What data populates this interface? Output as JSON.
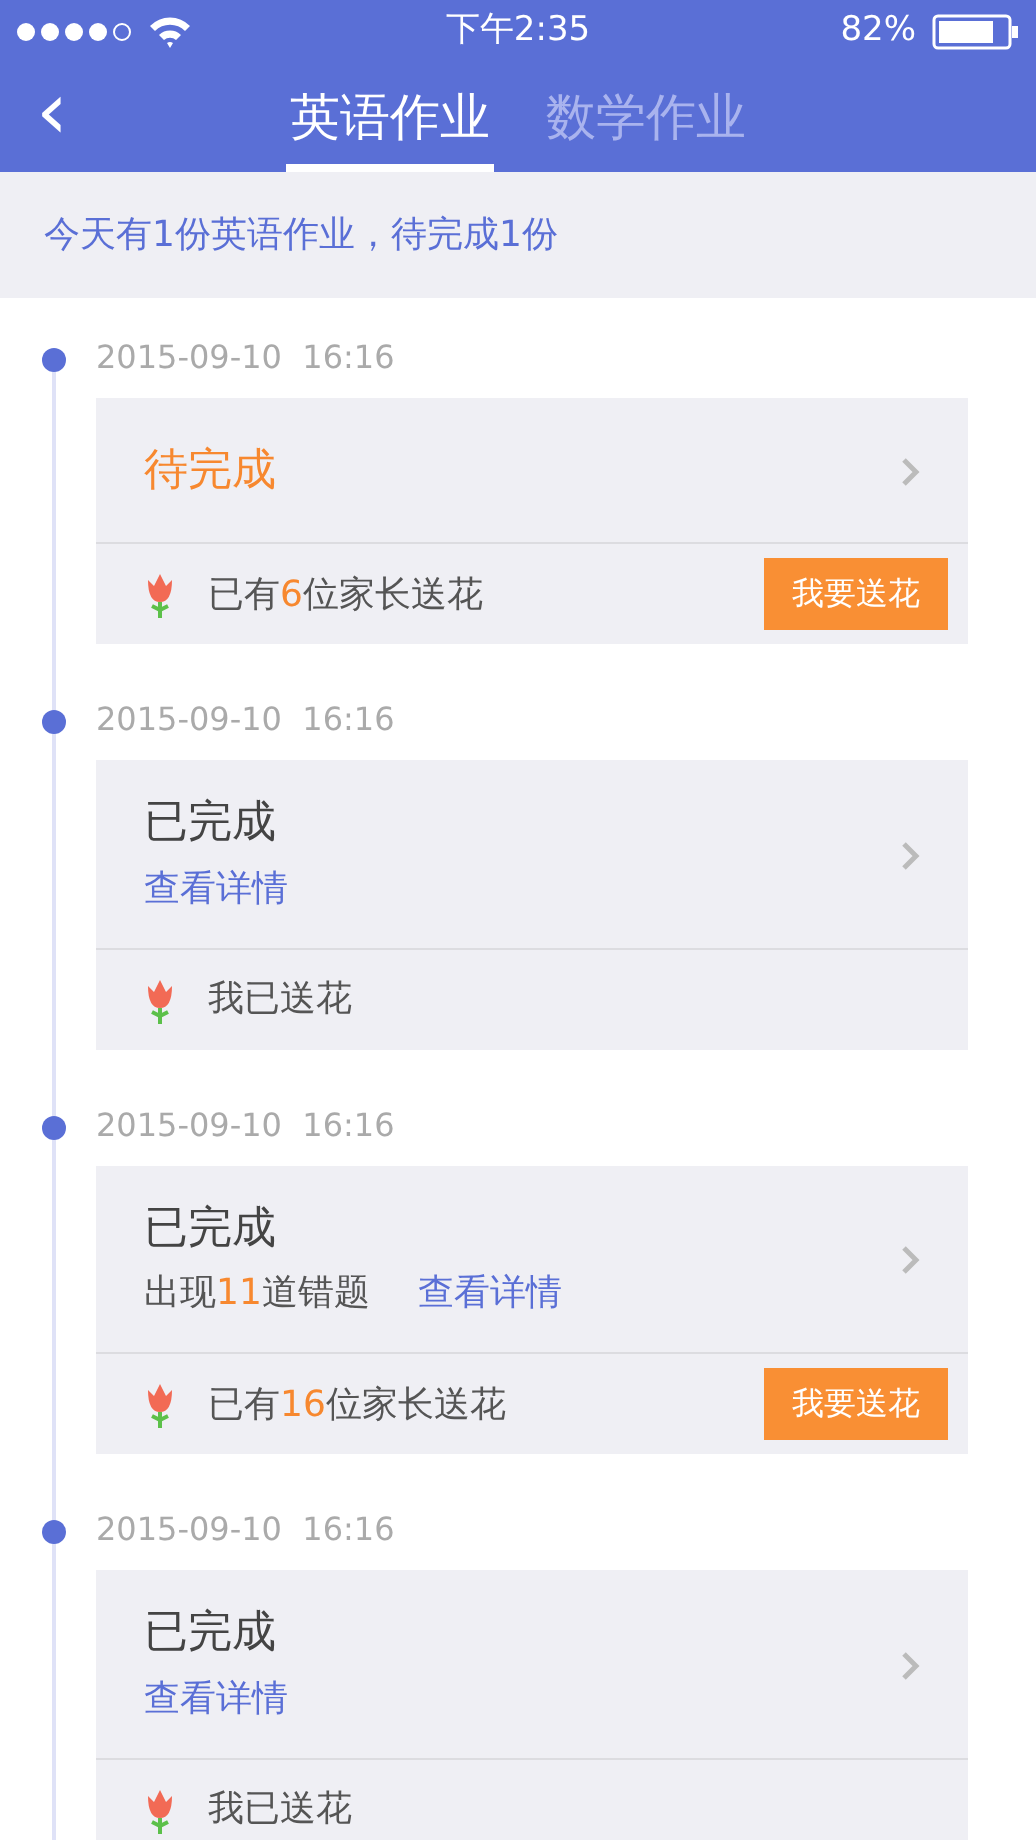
{
  "status_bar": {
    "time": "下午2:35",
    "battery": "82%"
  },
  "nav": {
    "back": "‹",
    "tabs": [
      {
        "label": "英语作业",
        "selected": true
      },
      {
        "label": "数学作业",
        "selected": false
      }
    ]
  },
  "summary": "今天有1份英语作业，待完成1份",
  "entries": [
    {
      "datetime": "2015-09-10  16:16",
      "title": "待完成",
      "completed": false,
      "flower_parts": [
        {
          "text": "已有",
          "highlight": false
        },
        {
          "text": "6",
          "highlight": true
        },
        {
          "text": "位家长送花",
          "highlight": false
        }
      ],
      "button": "我要送花"
    },
    {
      "datetime": "2015-09-10  16:16",
      "title": "已完成",
      "completed": true,
      "link": "查看详情",
      "flower_parts": [
        {
          "text": "我已送花",
          "highlight": false
        }
      ]
    },
    {
      "datetime": "2015-09-10  16:16",
      "title": "已完成",
      "completed": true,
      "note_parts": [
        {
          "text": "出现",
          "highlight": false
        },
        {
          "text": "11",
          "highlight": true
        },
        {
          "text": "道错题",
          "highlight": false
        }
      ],
      "link": "查看详情",
      "flower_parts": [
        {
          "text": "已有",
          "highlight": false
        },
        {
          "text": "16",
          "highlight": true
        },
        {
          "text": "位家长送花",
          "highlight": false
        }
      ],
      "button": "我要送花"
    },
    {
      "datetime": "2015-09-10  16:16",
      "title": "已完成",
      "completed": true,
      "link": "查看详情",
      "flower_parts": [
        {
          "text": "我已送花",
          "highlight": false
        }
      ]
    }
  ]
}
